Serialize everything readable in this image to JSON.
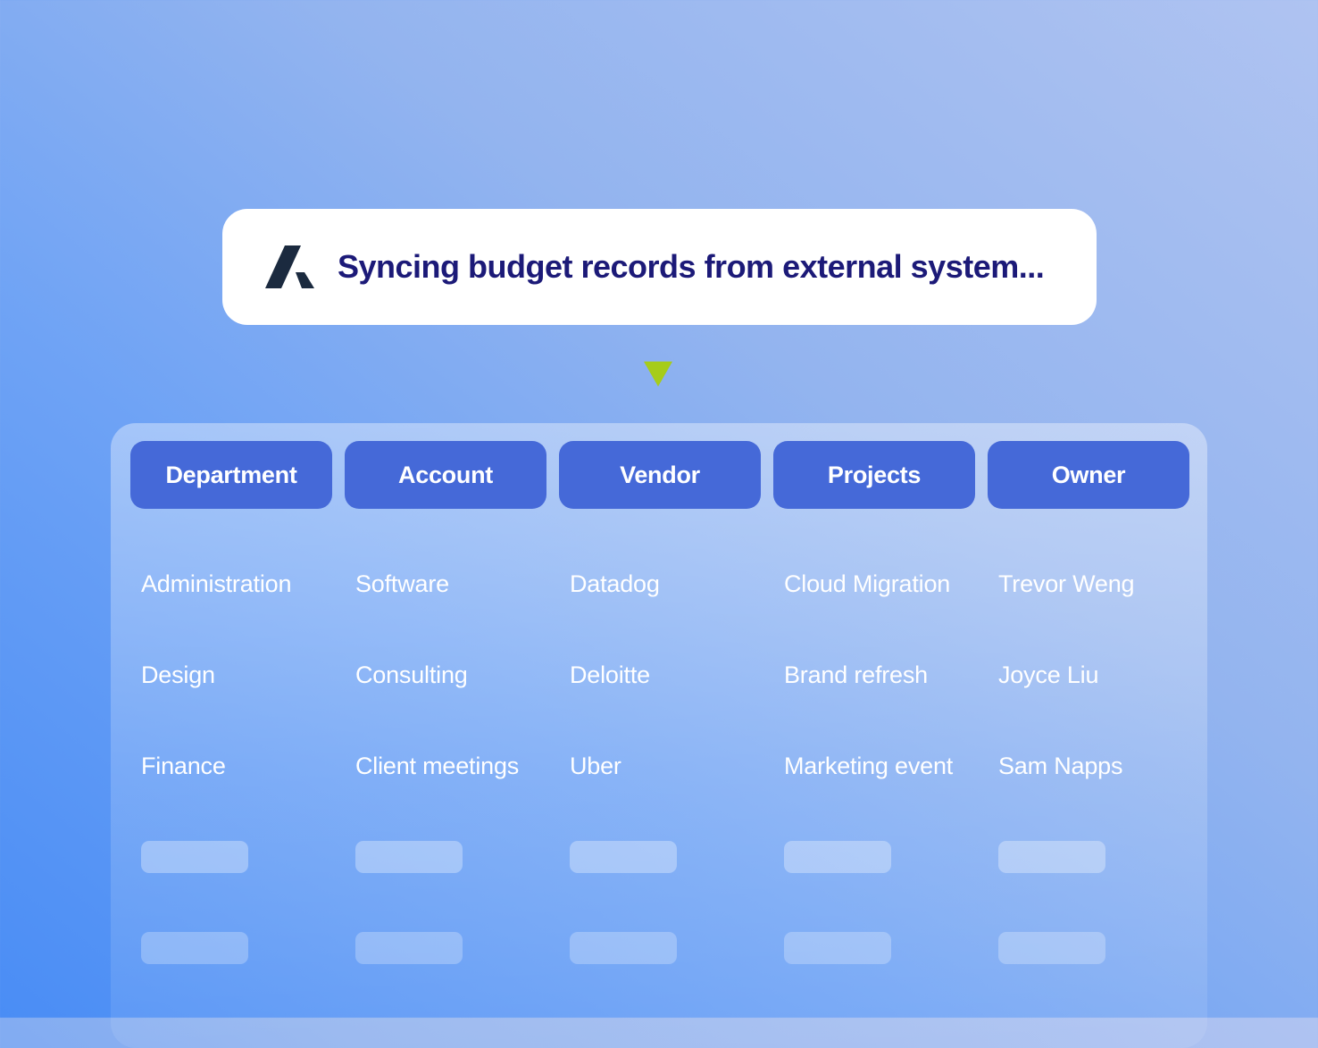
{
  "banner": {
    "logo_icon": "a-logo-icon",
    "message": "Syncing budget records from external system...",
    "text_color": "#1c1a78"
  },
  "arrow_icon": "arrow-down-icon",
  "arrow_color": "#a6cc1a",
  "table": {
    "header_color": "#4569d8",
    "columns": [
      "Department",
      "Account",
      "Vendor",
      "Projects",
      "Owner"
    ],
    "rows": [
      [
        "Administration",
        "Software",
        "Datadog",
        "Cloud Migration",
        "Trevor Weng"
      ],
      [
        "Design",
        "Consulting",
        "Deloitte",
        "Brand refresh",
        "Joyce Liu"
      ],
      [
        "Finance",
        "Client meetings",
        "Uber",
        "Marketing event",
        "Sam Napps"
      ]
    ]
  }
}
